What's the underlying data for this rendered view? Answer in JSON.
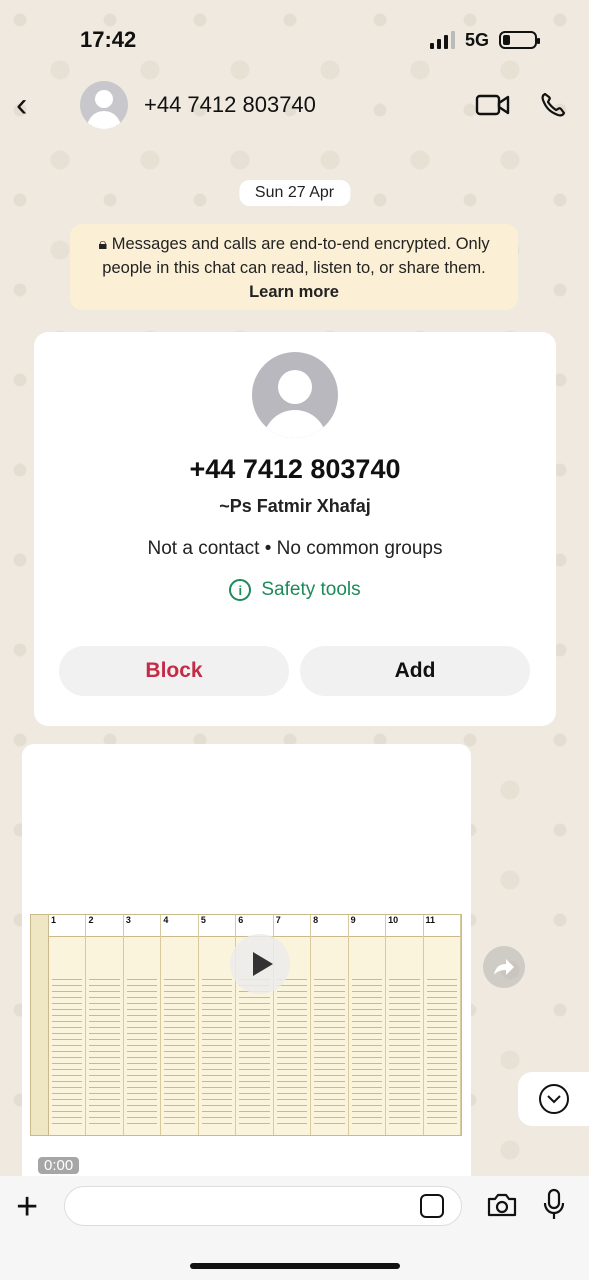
{
  "status": {
    "time": "17:42",
    "network": "5G"
  },
  "header": {
    "title": "+44 7412 803740"
  },
  "chat": {
    "date": "Sun 27 Apr",
    "e2e_text": "Messages and calls are end-to-end encrypted. Only people in this chat can read, listen to, or share them.",
    "e2e_link": "Learn more"
  },
  "contact_card": {
    "number": "+44 7412 803740",
    "name": "~Ps Fatmir Xhafaj",
    "info": "Not a contact • No common groups",
    "safety": "Safety tools",
    "block_label": "Block",
    "add_label": "Add"
  },
  "video": {
    "duration": "0:00",
    "columns": [
      "1",
      "2",
      "3",
      "4",
      "5",
      "6",
      "7",
      "8",
      "9",
      "10",
      "11"
    ]
  },
  "input": {
    "placeholder": ""
  },
  "colors": {
    "accent_green": "#1d8a5b",
    "block_red": "#c42b46",
    "banner": "#fbf0d6"
  }
}
